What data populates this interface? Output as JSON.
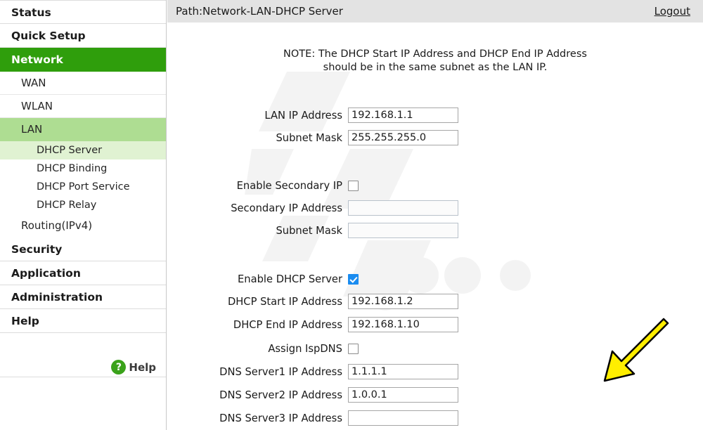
{
  "header": {
    "breadcrumb": "Path:Network-LAN-DHCP Server",
    "logout_label": "Logout"
  },
  "sidebar": {
    "sections": [
      {
        "label": "Status",
        "active": false
      },
      {
        "label": "Quick Setup",
        "active": false
      },
      {
        "label": "Network",
        "active": true
      },
      {
        "label": "Security",
        "active": false
      },
      {
        "label": "Application",
        "active": false
      },
      {
        "label": "Administration",
        "active": false
      },
      {
        "label": "Help",
        "active": false
      }
    ],
    "network_items": [
      {
        "label": "WAN"
      },
      {
        "label": "WLAN"
      },
      {
        "label": "LAN"
      },
      {
        "label": "DHCP Server"
      },
      {
        "label": "DHCP Binding"
      },
      {
        "label": "DHCP Port Service"
      },
      {
        "label": "DHCP Relay"
      },
      {
        "label": "Routing(IPv4)"
      }
    ],
    "help_button": {
      "label": "Help",
      "icon": "question-mark-icon",
      "icon_glyph": "?"
    }
  },
  "main": {
    "note_line1": "NOTE: The DHCP Start IP Address and DHCP End IP Address",
    "note_line2": "should be in the same subnet as the LAN IP.",
    "fields": {
      "lan_ip_label": "LAN IP Address",
      "lan_ip_value": "192.168.1.1",
      "subnet_mask_label": "Subnet Mask",
      "subnet_mask_value": "255.255.255.0",
      "enable_secondary_ip_label": "Enable Secondary IP",
      "secondary_ip_label": "Secondary IP Address",
      "secondary_ip_value": "",
      "secondary_subnet_label": "Subnet Mask",
      "secondary_subnet_value": "",
      "enable_dhcp_label": "Enable DHCP Server",
      "dhcp_start_label": "DHCP Start IP Address",
      "dhcp_start_value": "192.168.1.2",
      "dhcp_end_label": "DHCP End IP Address",
      "dhcp_end_value": "192.168.1.10",
      "assign_ispdns_label": "Assign IspDNS",
      "dns1_label": "DNS Server1 IP Address",
      "dns1_value": "1.1.1.1",
      "dns2_label": "DNS Server2 IP Address",
      "dns2_value": "1.0.0.1",
      "dns3_label": "DNS Server3 IP Address",
      "dns3_value": ""
    }
  },
  "annotation": {
    "type": "arrow",
    "color": "#ffee00",
    "outline": "#000000",
    "points_to": "DNS Server1 IP Address"
  },
  "colors": {
    "section_active_bg": "#2f9e0c",
    "item_selected_bg": "#aedd92",
    "sub_selected_bg": "#e0f2d2",
    "header_bg": "#e3e3e3",
    "checkbox_checked": "#1a8cf0"
  }
}
